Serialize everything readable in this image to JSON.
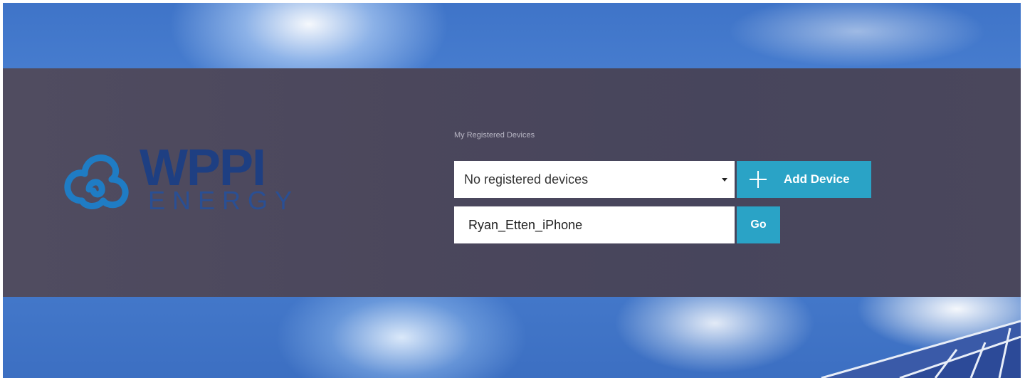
{
  "brand": {
    "name": "WPPI",
    "subtitle": "ENERGY",
    "primary_color": "#1e3f82",
    "logo_icon": "cloud-swirl-logo"
  },
  "devices": {
    "section_label": "My Registered Devices",
    "selected_device": "No registered devices",
    "add_device_label": "Add Device",
    "add_device_icon": "plus-icon",
    "device_name_value": "Ryan_Etten_iPhone",
    "go_label": "Go",
    "accent_color": "#2aa3c6"
  }
}
